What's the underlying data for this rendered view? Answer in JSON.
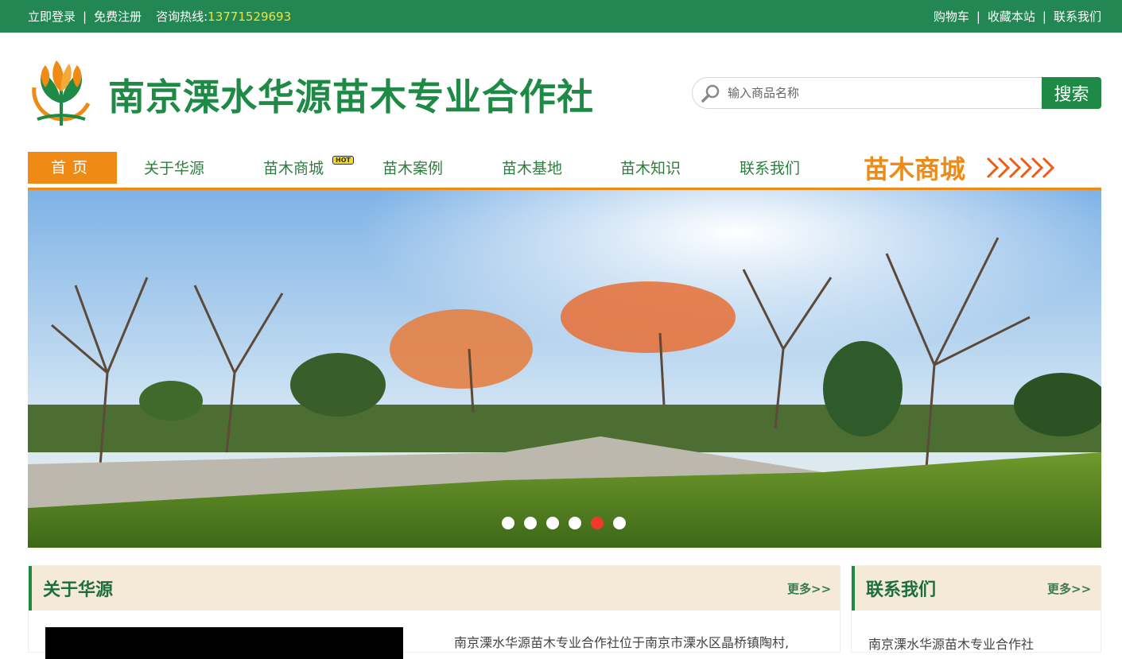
{
  "topbar": {
    "login": "立即登录",
    "register": "免费注册",
    "hotline_label": "咨询热线:",
    "hotline_number": "13771529693",
    "cart": "购物车",
    "bookmark": "收藏本站",
    "contact": "联系我们",
    "separator": "|"
  },
  "header": {
    "site_title": "南京溧水华源苗木专业合作社",
    "search_placeholder": "输入商品名称",
    "search_button": "搜索"
  },
  "nav": {
    "items": [
      {
        "label": "首页"
      },
      {
        "label": "关于华源"
      },
      {
        "label": "苗木商城"
      },
      {
        "label": "苗木案例"
      },
      {
        "label": "苗木基地"
      },
      {
        "label": "苗木知识"
      },
      {
        "label": "联系我们"
      }
    ],
    "hot_badge": "HOT",
    "mall_banner": "苗木商城"
  },
  "banner": {
    "slide_count": 6,
    "active_slide": 5
  },
  "sections": {
    "about": {
      "title": "关于华源",
      "more": "更多>>",
      "text": "南京溧水华源苗木专业合作社位于南京市溧水区晶桥镇陶村,"
    },
    "contact": {
      "title": "联系我们",
      "more": "更多>>",
      "text": "南京溧水华源苗木专业合作社"
    }
  },
  "colors": {
    "brand_green": "#228752",
    "accent_orange": "#ef8a14",
    "hotline_yellow": "#f4e23a",
    "active_dot": "#ef3a2a"
  }
}
